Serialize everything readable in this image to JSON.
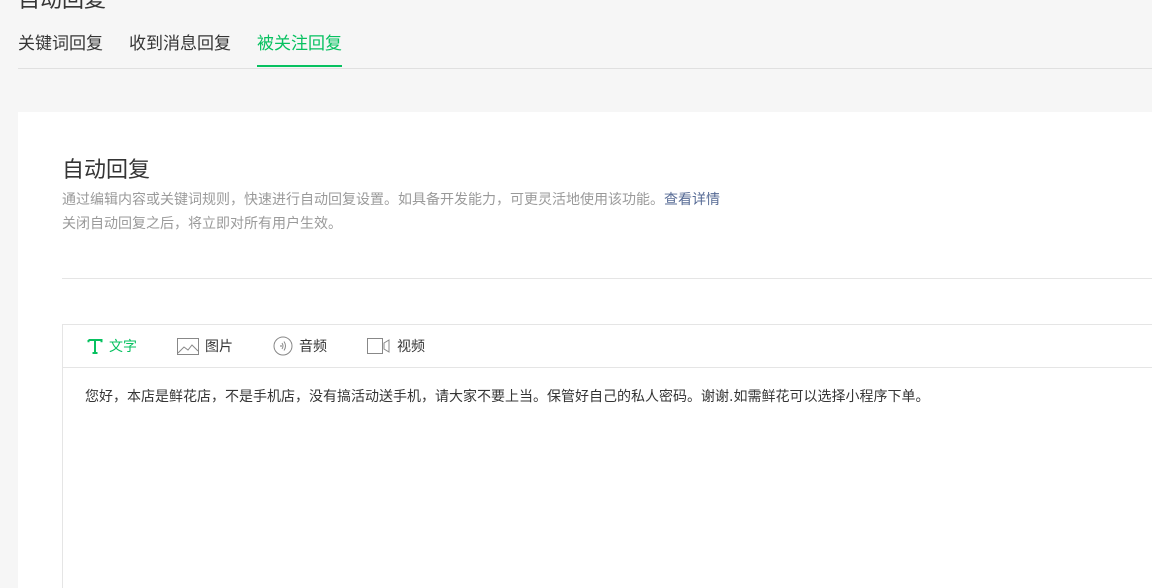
{
  "page": {
    "heading": "自动回复"
  },
  "tabs": [
    {
      "label": "关键词回复",
      "active": false
    },
    {
      "label": "收到消息回复",
      "active": false
    },
    {
      "label": "被关注回复",
      "active": true
    }
  ],
  "card": {
    "title": "自动回复",
    "desc_line1": "通过编辑内容或关键词规则，快速进行自动回复设置。如具备开发能力，可更灵活地使用该功能。",
    "desc_link": "查看详情",
    "desc_line2": "关闭自动回复之后，将立即对所有用户生效。"
  },
  "editor": {
    "toolbar": [
      {
        "label": "文字",
        "icon": "text-icon",
        "active": true
      },
      {
        "label": "图片",
        "icon": "image-icon",
        "active": false
      },
      {
        "label": "音频",
        "icon": "audio-icon",
        "active": false
      },
      {
        "label": "视频",
        "icon": "video-icon",
        "active": false
      }
    ],
    "content": "您好，本店是鲜花店，不是手机店，没有搞活动送手机，请大家不要上当。保管好自己的私人密码。谢谢.如需鲜花可以选择小程序下单。"
  },
  "colors": {
    "accent": "#07c160",
    "link": "#576b95",
    "muted_text": "#9a9a9a",
    "background": "#f6f6f6"
  }
}
